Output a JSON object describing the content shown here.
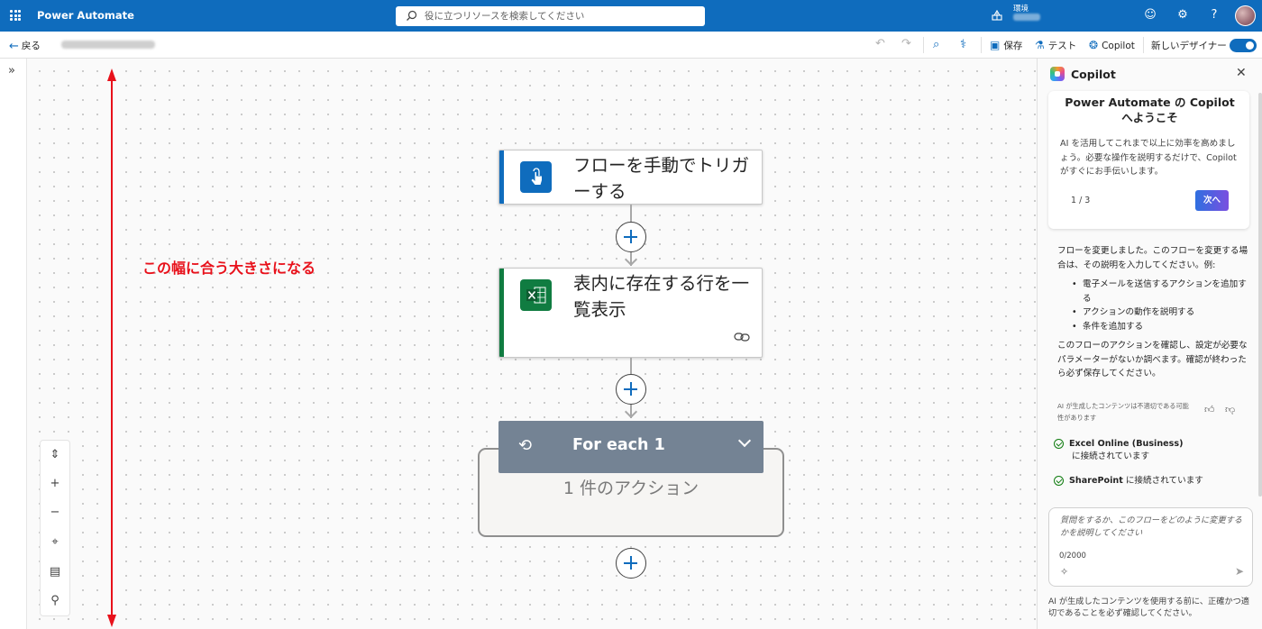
{
  "app": {
    "title": "Power Automate"
  },
  "search": {
    "placeholder": "役に立つリソースを検索してください"
  },
  "environment": {
    "label": "環境"
  },
  "commandbar": {
    "back": "戻る",
    "save": "保存",
    "test": "テスト",
    "copilot": "Copilot",
    "new_designer": "新しいデザイナー",
    "new_designer_on": true
  },
  "annotation": {
    "text": "この幅に合う大きさになる",
    "color": "#e8111b"
  },
  "flow": {
    "trigger": {
      "title": "フローを手動でトリガーする",
      "accent": "#0f6cbd",
      "icon": "touch-hand-icon"
    },
    "action": {
      "title": "表内に存在する行を一覧表示",
      "accent": "#107c41",
      "icon": "excel-icon"
    },
    "foreach": {
      "title": "For each 1",
      "subtitle": "1 件のアクション",
      "color": "#748394"
    }
  },
  "copilot": {
    "title": "Copilot",
    "welcome": {
      "title": "Power Automate の Copilot へようこそ",
      "body": "AI を活用してこれまで以上に効率を高めましょう。必要な操作を説明するだけで、Copilot がすぐにお手伝いします。",
      "page": "1 / 3",
      "next": "次へ"
    },
    "message": {
      "intro": "フローを変更しました。このフローを変更する場合は、その説明を入力してください。例:",
      "examples": [
        "電子メールを送信するアクションを追加する",
        "アクションの動作を説明する",
        "条件を追加する"
      ],
      "outro": "このフローのアクションを確認し、設定が必要なパラメーターがないか調べます。確認が終わったら必ず保存してください。",
      "disclaimer": "AI が生成したコンテンツは不適切である可能性があります"
    },
    "connections": [
      {
        "name": "Excel Online (Business)",
        "status": "に接続されています"
      },
      {
        "name": "SharePoint",
        "status": "に接続されています"
      }
    ],
    "input": {
      "placeholder": "質問をするか、このフローをどのように変更するかを説明してください",
      "count": "0/2000"
    },
    "footer": "AI が生成したコンテンツを使用する前に、正確かつ適切であることを必ず確認してください。"
  }
}
